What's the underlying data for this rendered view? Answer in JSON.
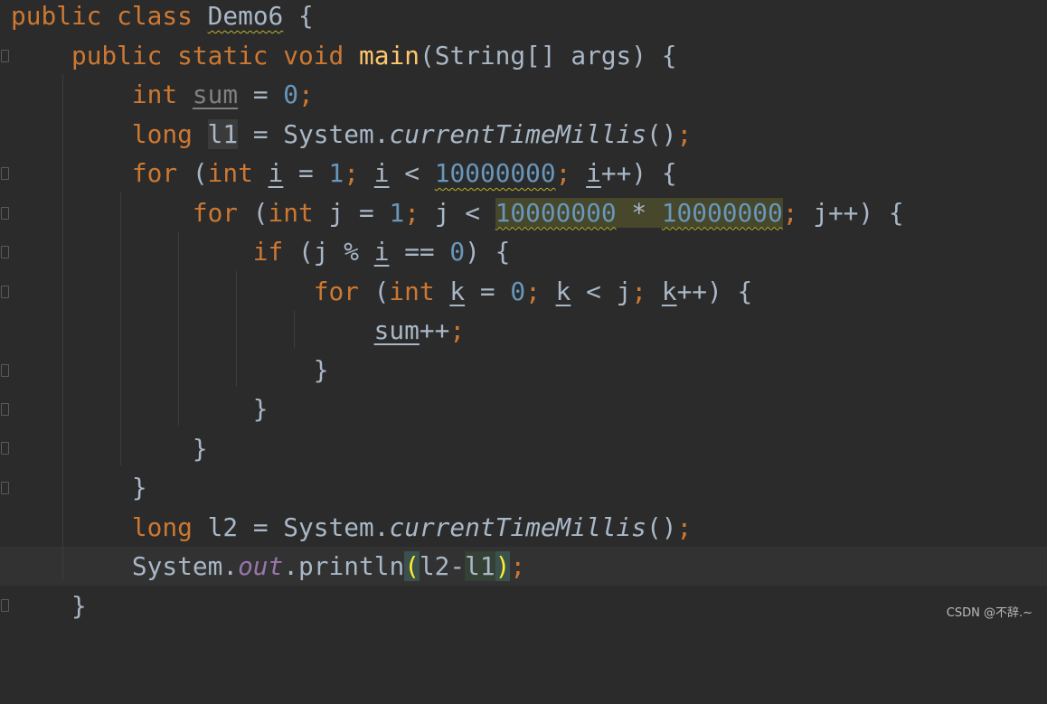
{
  "editor": {
    "language": "Java",
    "theme": "Darcula",
    "lines": [
      "public class Demo6 {",
      "    public static void main(String[] args) {",
      "        int sum = 0;",
      "        long l1 = System.currentTimeMillis();",
      "        for (int i = 1; i < 10000000; i++) {",
      "            for (int j = 1; j < 10000000 * 10000000; j++) {",
      "                if (j % i == 0) {",
      "                    for (int k = 0; k < j; k++) {",
      "                        sum++;",
      "                    }",
      "                }",
      "            }",
      "        }",
      "        long l2 = System.currentTimeMillis();",
      "        System.out.println(l2-l1);",
      "    }"
    ],
    "current_line": 15
  },
  "tokens": {
    "public": "public",
    "class": "class",
    "class_name": "Demo6",
    "static": "static",
    "void": "void",
    "main": "main",
    "string_arr": "String[]",
    "args": "args",
    "int": "int",
    "long": "long",
    "for": "for",
    "if": "if",
    "sum": "sum",
    "zero": "0",
    "one": "1",
    "ten_million": "10000000",
    "i": "i",
    "j": "j",
    "k": "k",
    "l1": "l1",
    "l2": "l2",
    "system": "System",
    "current_time_millis": "currentTimeMillis",
    "out": "out",
    "println": "println",
    "open_brace": "{",
    "close_brace": "}"
  },
  "watermark": "CSDN @不辞.~",
  "colors": {
    "background": "#2b2b2b",
    "keyword": "#cc7832",
    "number": "#6897bb",
    "method": "#ffc66d",
    "field": "#9876aa",
    "default_text": "#a9b7c6",
    "warning_wave": "#bbb529"
  }
}
